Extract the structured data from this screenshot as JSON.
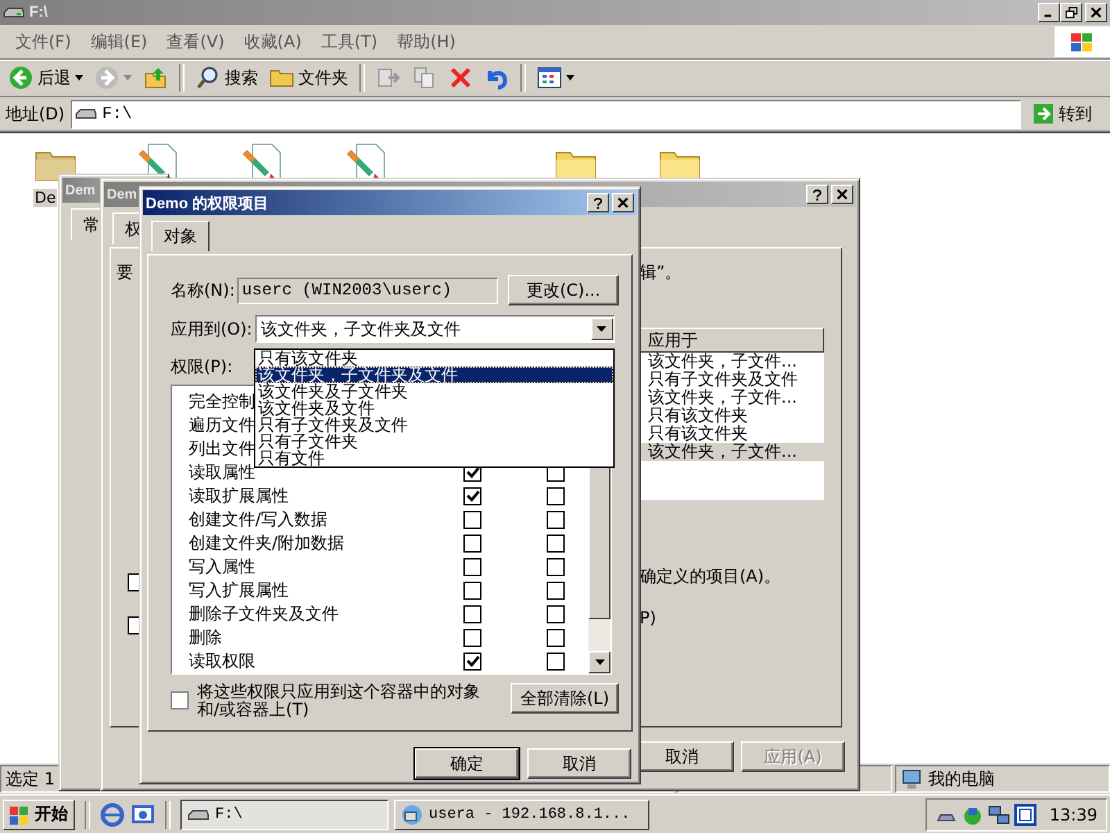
{
  "explorer": {
    "title": "F:\\",
    "active": false,
    "menu": [
      "文件(F)",
      "编辑(E)",
      "查看(V)",
      "收藏(A)",
      "工具(T)",
      "帮助(H)"
    ],
    "toolbar": {
      "back": "后退",
      "search": "搜索",
      "folders": "文件夹"
    },
    "address": {
      "label": "地址(D)",
      "value": "F:\\",
      "go": "转到"
    },
    "files": [
      {
        "kind": "folder",
        "label": "De",
        "selected": true
      },
      {
        "kind": "image",
        "selected": false
      },
      {
        "kind": "image",
        "selected": false
      },
      {
        "kind": "image",
        "selected": false
      },
      {
        "kind": "folder",
        "selected": false
      },
      {
        "kind": "folder",
        "selected": false
      }
    ],
    "status_bar": {
      "selection": "选定 1",
      "zone": "我的电脑"
    }
  },
  "back_window_1": {
    "title": "Dem",
    "active": false,
    "tab": "常"
  },
  "back_window_2": {
    "title": "Dem",
    "active": false,
    "tab": "权",
    "intro_fragment": "要",
    "note_fragment": "辑”。",
    "inherit_header": "应用于",
    "inherit_rows": [
      {
        "text": "该文件夹，子文件...",
        "selected": false
      },
      {
        "text": "只有子文件夹及文件",
        "selected": false
      },
      {
        "text": "该文件夹，子文件...",
        "selected": false
      },
      {
        "text": "只有该文件夹",
        "selected": false
      },
      {
        "text": "只有该文件夹",
        "selected": false
      },
      {
        "text": "该文件夹，子文件...",
        "selected": true
      }
    ],
    "options": [
      {
        "text": "确定义的项目(A)。",
        "checked": false
      },
      {
        "text": "P)",
        "checked": false
      }
    ],
    "buttons": [
      {
        "label": "取消",
        "disabled": false
      },
      {
        "label": "应用(A)",
        "disabled": true
      }
    ]
  },
  "permission_dialog": {
    "title": "Demo 的权限项目",
    "active": true,
    "tabs": [
      {
        "label": "对象",
        "selected": true
      }
    ],
    "name_label": "名称(N):",
    "name_value": "userc (WIN2003\\userc)",
    "change_button": "更改(C)...",
    "apply_label": "应用到(O):",
    "apply_value": "该文件夹，子文件夹及文件",
    "apply_options": [
      {
        "text": "只有该文件夹",
        "selected": false
      },
      {
        "text": "该文件夹，子文件夹及文件",
        "selected": true
      },
      {
        "text": "该文件夹及子文件夹",
        "selected": false
      },
      {
        "text": "该文件夹及文件",
        "selected": false
      },
      {
        "text": "只有子文件夹及文件",
        "selected": false
      },
      {
        "text": "只有子文件夹",
        "selected": false
      },
      {
        "text": "只有文件",
        "selected": false
      }
    ],
    "permissions_label": "权限(P):",
    "permissions": [
      {
        "name": "完全控制"
      },
      {
        "name": "遍历文件"
      },
      {
        "name": "列出文件"
      },
      {
        "name": "读取属性",
        "allow": true,
        "deny": false
      },
      {
        "name": "读取扩展属性",
        "allow": true,
        "deny": false
      },
      {
        "name": "创建文件/写入数据",
        "allow": false,
        "deny": false
      },
      {
        "name": "创建文件夹/附加数据",
        "allow": false,
        "deny": false
      },
      {
        "name": "写入属性",
        "allow": false,
        "deny": false
      },
      {
        "name": "写入扩展属性",
        "allow": false,
        "deny": false
      },
      {
        "name": "删除子文件夹及文件",
        "allow": false,
        "deny": false
      },
      {
        "name": "删除",
        "allow": false,
        "deny": false
      },
      {
        "name": "读取权限",
        "allow": true,
        "deny": false
      }
    ],
    "container_only": {
      "text": "将这些权限只应用到这个容器中的对象和/或容器上(T)",
      "checked": false
    },
    "clear_button": "全部清除(L)",
    "buttons": [
      {
        "label": "确定",
        "default": true
      },
      {
        "label": "取消",
        "default": false
      }
    ]
  },
  "taskbar": {
    "start": "开始",
    "tasks": [
      {
        "label": "F:\\",
        "selected": true,
        "kind": "drive"
      },
      {
        "label": "usera - 192.168.8.1...",
        "selected": false,
        "kind": "remote"
      }
    ],
    "clock": "13:39"
  }
}
